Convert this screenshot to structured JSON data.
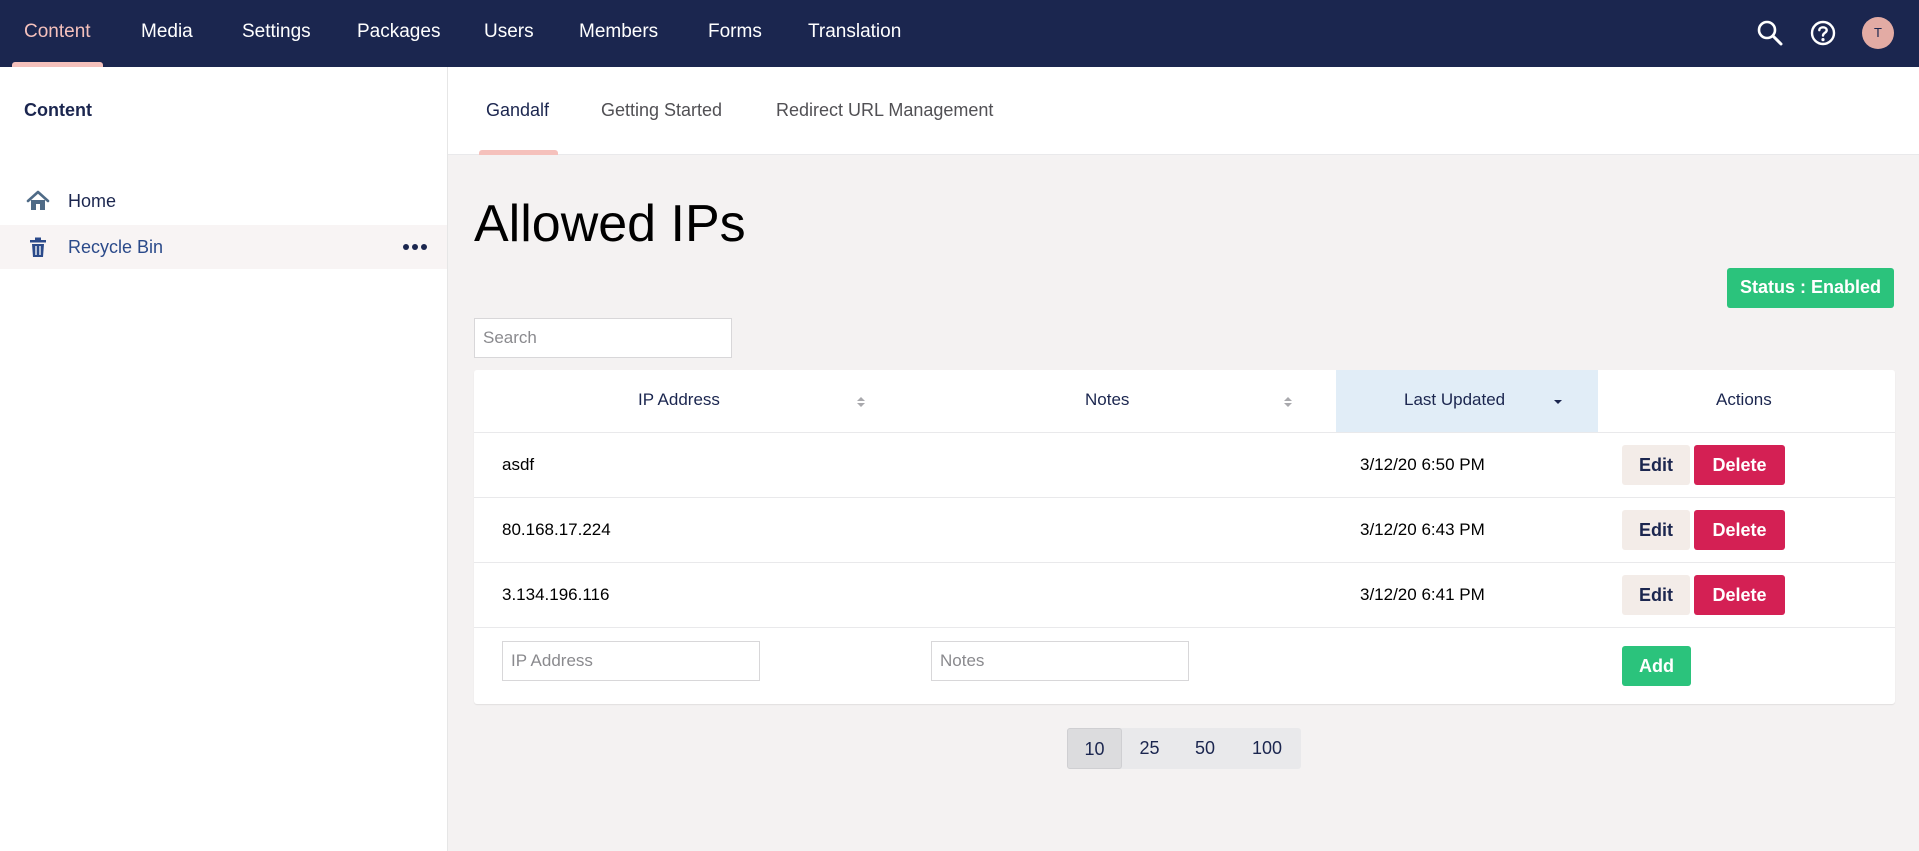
{
  "nav": {
    "items": [
      {
        "label": "Content",
        "active": true
      },
      {
        "label": "Media"
      },
      {
        "label": "Settings"
      },
      {
        "label": "Packages"
      },
      {
        "label": "Users"
      },
      {
        "label": "Members"
      },
      {
        "label": "Forms"
      },
      {
        "label": "Translation"
      }
    ],
    "icons": [
      "search-icon",
      "help-icon"
    ],
    "avatar_initial": "T"
  },
  "sidebar": {
    "title": "Content",
    "items": [
      {
        "label": "Home",
        "icon": "home-icon"
      },
      {
        "label": "Recycle Bin",
        "icon": "trash-icon",
        "selected": true
      }
    ]
  },
  "tabs": [
    {
      "label": "Gandalf",
      "active": true
    },
    {
      "label": "Getting Started"
    },
    {
      "label": "Redirect URL Management"
    }
  ],
  "main": {
    "title": "Allowed IPs",
    "status_label": "Status : Enabled",
    "search_placeholder": "Search",
    "table": {
      "headers": {
        "ip": "IP Address",
        "notes": "Notes",
        "updated": "Last Updated",
        "actions": "Actions"
      },
      "sorted_column": "Last Updated",
      "sort_direction": "descending",
      "rows": [
        {
          "ip": "asdf",
          "notes": "",
          "updated": "3/12/20 6:50 PM"
        },
        {
          "ip": "80.168.17.224",
          "notes": "",
          "updated": "3/12/20 6:43 PM"
        },
        {
          "ip": "3.134.196.116",
          "notes": "",
          "updated": "3/12/20 6:41 PM"
        }
      ],
      "edit_label": "Edit",
      "delete_label": "Delete",
      "new_row": {
        "ip_placeholder": "IP Address",
        "notes_placeholder": "Notes",
        "add_label": "Add"
      }
    },
    "page_sizes": [
      "10",
      "25",
      "50",
      "100"
    ],
    "selected_page_size": "10"
  },
  "colors": {
    "topbar": "#1b264f",
    "accent": "#f5c1bc",
    "success": "#2bc37c",
    "danger": "#d42054",
    "sorted_header": "#e1edf7"
  }
}
